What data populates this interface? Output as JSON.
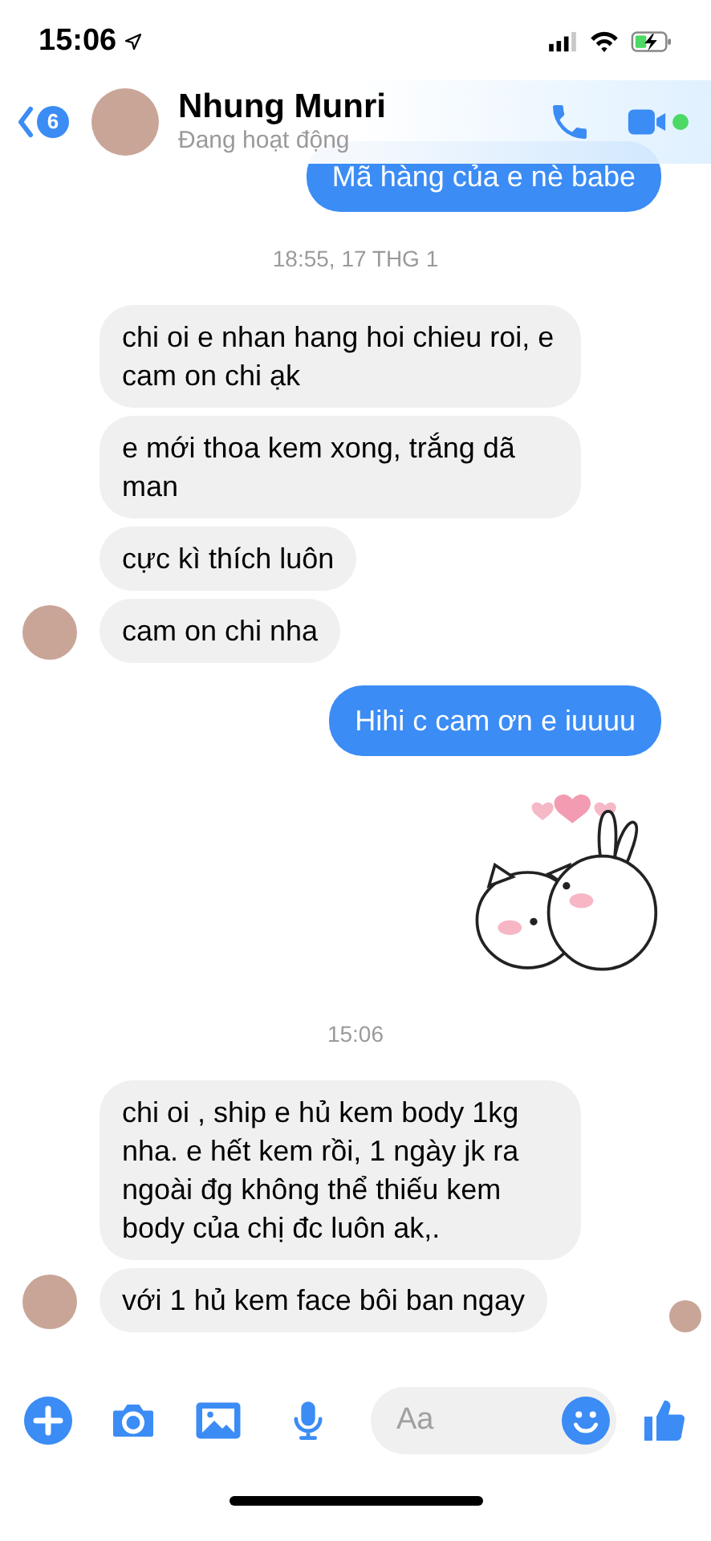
{
  "status_bar": {
    "time": "15:06",
    "charging": true
  },
  "header": {
    "back_count": "6",
    "name": "Nhung Munri",
    "status": "Đang hoạt động",
    "online": true
  },
  "messages": [
    {
      "kind": "text",
      "outgoing": true,
      "text": "Mã hàng của e nè babe"
    },
    {
      "kind": "time",
      "text": "18:55, 17 THG 1"
    },
    {
      "kind": "text",
      "outgoing": false,
      "text": "chi oi e nhan hang hoi chieu roi, e cam on chi ạk",
      "avatar": false
    },
    {
      "kind": "text",
      "outgoing": false,
      "text": "e mới thoa kem xong, trắng dã man",
      "avatar": false
    },
    {
      "kind": "text",
      "outgoing": false,
      "text": "cực kì thích luôn",
      "avatar": false
    },
    {
      "kind": "text",
      "outgoing": false,
      "text": "cam on chi nha",
      "avatar": true
    },
    {
      "kind": "text",
      "outgoing": true,
      "text": "Hihi c cam ơn e iuuuu"
    },
    {
      "kind": "sticker",
      "outgoing": true
    },
    {
      "kind": "time",
      "text": "15:06"
    },
    {
      "kind": "text",
      "outgoing": false,
      "text": "chi oi , ship e hủ kem body 1kg nha. e hết kem rồi, 1 ngày jk ra ngoài đg không thể thiếu kem body của chị đc luôn ak,.",
      "avatar": false
    },
    {
      "kind": "text",
      "outgoing": false,
      "text": "với 1 hủ kem face bôi ban ngay",
      "avatar": true,
      "seen": true
    }
  ],
  "composer": {
    "placeholder": "Aa"
  }
}
